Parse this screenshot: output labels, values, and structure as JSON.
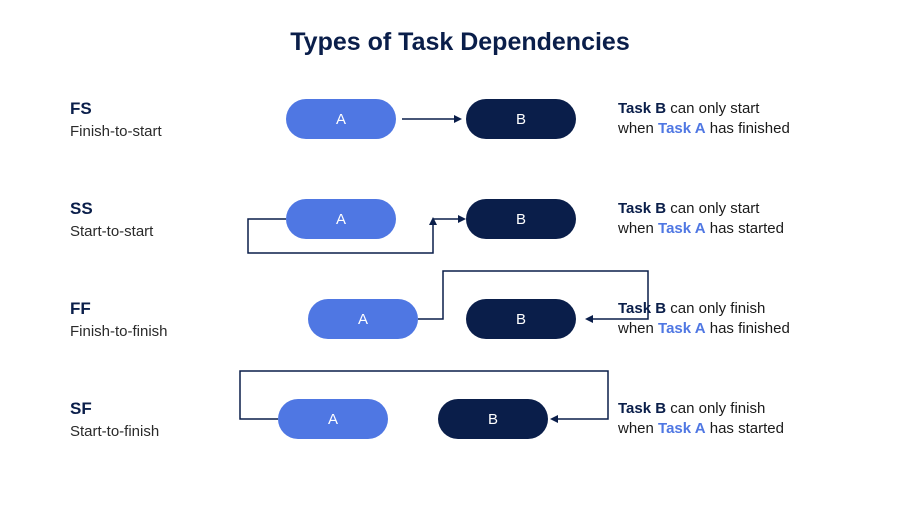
{
  "title": "Types of Task Dependencies",
  "labelA": "A",
  "labelB": "B",
  "rows": [
    {
      "abbr": "FS",
      "name": "Finish-to-start",
      "desc_lead": "Task B",
      "desc_mid1": " can only start when ",
      "desc_taskA": "Task A",
      "desc_tail": " has finished"
    },
    {
      "abbr": "SS",
      "name": "Start-to-start",
      "desc_lead": "Task B",
      "desc_mid1": " can only start when ",
      "desc_taskA": "Task A",
      "desc_tail": " has started"
    },
    {
      "abbr": "FF",
      "name": "Finish-to-finish",
      "desc_lead": "Task B",
      "desc_mid1": " can only finish when ",
      "desc_taskA": "Task A",
      "desc_tail": " has finished"
    },
    {
      "abbr": "SF",
      "name": "Start-to-finish",
      "desc_lead": "Task B",
      "desc_mid1": " can only finish when ",
      "desc_taskA": "Task A",
      "desc_tail": " has started"
    }
  ],
  "colors": {
    "pillA": "#4f77e3",
    "pillB": "#0a1e4a",
    "stroke": "#0a1e4a"
  }
}
